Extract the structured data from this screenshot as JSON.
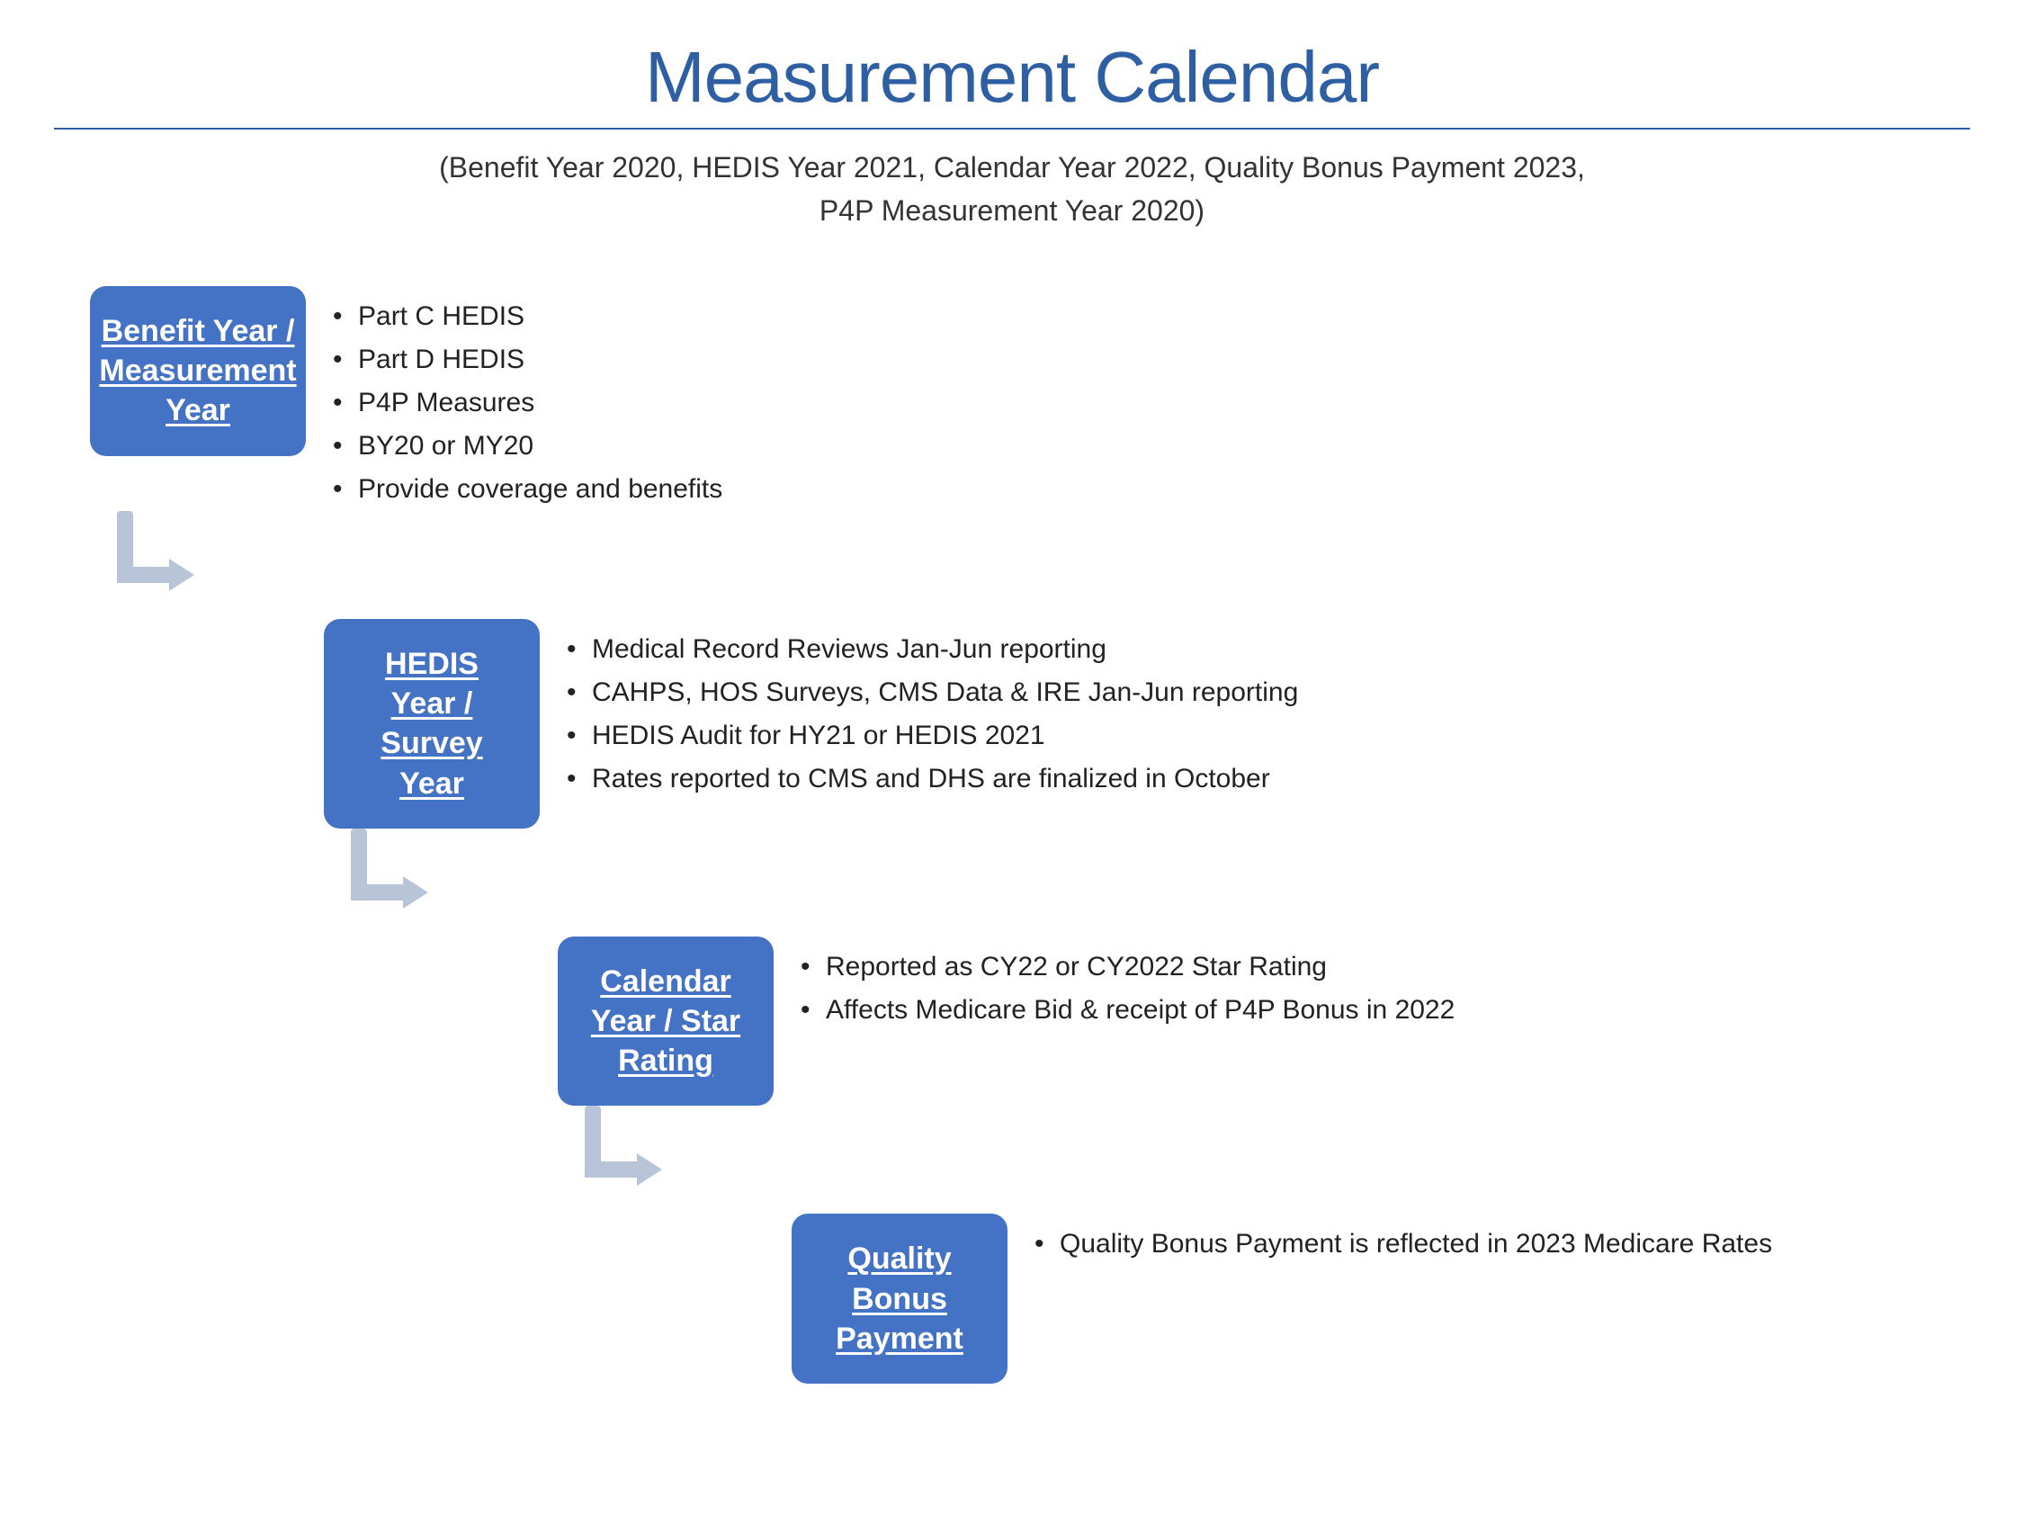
{
  "page": {
    "title": "Measurement Calendar",
    "subtitle": "(Benefit Year 2020, HEDIS Year 2021, Calendar Year 2022, Quality Bonus Payment 2023,\nP4P Measurement Year 2020)"
  },
  "boxes": {
    "benefit_year": "Benefit Year / Measurement Year",
    "hedis_year": "HEDIS Year / Survey Year",
    "calendar_year": "Calendar Year / Star Rating",
    "quality_bonus": "Quality Bonus Payment"
  },
  "bullets": {
    "benefit_year": [
      "Part C HEDIS",
      "Part D HEDIS",
      "P4P Measures",
      "BY20 or MY20",
      "Provide coverage and benefits"
    ],
    "hedis_year": [
      "Medical Record Reviews Jan-Jun reporting",
      "CAHPS, HOS Surveys, CMS Data & IRE Jan-Jun reporting",
      "HEDIS Audit for HY21 or HEDIS 2021",
      "Rates reported to CMS and DHS are finalized in October"
    ],
    "calendar_year": [
      "Reported as CY22 or CY2022 Star Rating",
      "Affects Medicare Bid & receipt of P4P Bonus in 2022"
    ],
    "quality_bonus": [
      "Quality Bonus Payment is reflected in 2023 Medicare Rates"
    ]
  }
}
